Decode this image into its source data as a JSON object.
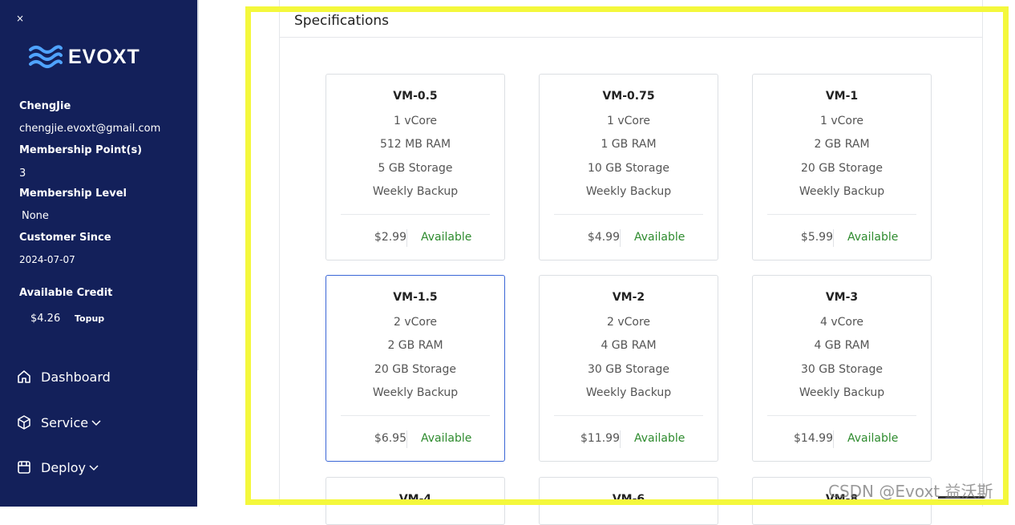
{
  "sidebar": {
    "close_label": "×",
    "brand": "EVOXT",
    "user": {
      "name": "ChengJie",
      "email": "chengjie.evoxt@gmail.com",
      "points_label": "Membership Point(s)",
      "points_value": "3",
      "level_label": "Membership Level",
      "level_value": "None",
      "since_label": "Customer Since",
      "since_value": "2024-07-07",
      "credit_label": "Available Credit",
      "credit_value": "$4.26",
      "topup_label": "Topup"
    },
    "nav": [
      {
        "label": "Dashboard",
        "icon": "home-icon"
      },
      {
        "label": "Service",
        "icon": "cube-icon"
      },
      {
        "label": "Deploy",
        "icon": "deploy-icon"
      }
    ]
  },
  "main": {
    "section_title": "Specifications",
    "plans": [
      {
        "name": "VM-0.5",
        "cpu": "1 vCore",
        "ram": "512 MB RAM",
        "storage": "5 GB Storage",
        "backup": "Weekly Backup",
        "price": "$2.99",
        "status": "Available",
        "selected": false
      },
      {
        "name": "VM-0.75",
        "cpu": "1 vCore",
        "ram": "1 GB RAM",
        "storage": "10 GB Storage",
        "backup": "Weekly Backup",
        "price": "$4.99",
        "status": "Available",
        "selected": false
      },
      {
        "name": "VM-1",
        "cpu": "1 vCore",
        "ram": "2 GB RAM",
        "storage": "20 GB Storage",
        "backup": "Weekly Backup",
        "price": "$5.99",
        "status": "Available",
        "selected": false
      },
      {
        "name": "VM-1.5",
        "cpu": "2 vCore",
        "ram": "2 GB RAM",
        "storage": "20 GB Storage",
        "backup": "Weekly Backup",
        "price": "$6.95",
        "status": "Available",
        "selected": true
      },
      {
        "name": "VM-2",
        "cpu": "2 vCore",
        "ram": "4 GB RAM",
        "storage": "30 GB Storage",
        "backup": "Weekly Backup",
        "price": "$11.99",
        "status": "Available",
        "selected": false
      },
      {
        "name": "VM-3",
        "cpu": "4 vCore",
        "ram": "4 GB RAM",
        "storage": "30 GB Storage",
        "backup": "Weekly Backup",
        "price": "$14.99",
        "status": "Available",
        "selected": false
      },
      {
        "name": "VM-4"
      },
      {
        "name": "VM-6"
      },
      {
        "name": "VM-8"
      }
    ]
  },
  "watermark": "CSDN @Evoxt 益沃斯",
  "colors": {
    "sidebar_bg": "#13205a",
    "available": "#2e8b2e",
    "selected_border": "#3a66d6",
    "highlight": "#f4f83c"
  }
}
